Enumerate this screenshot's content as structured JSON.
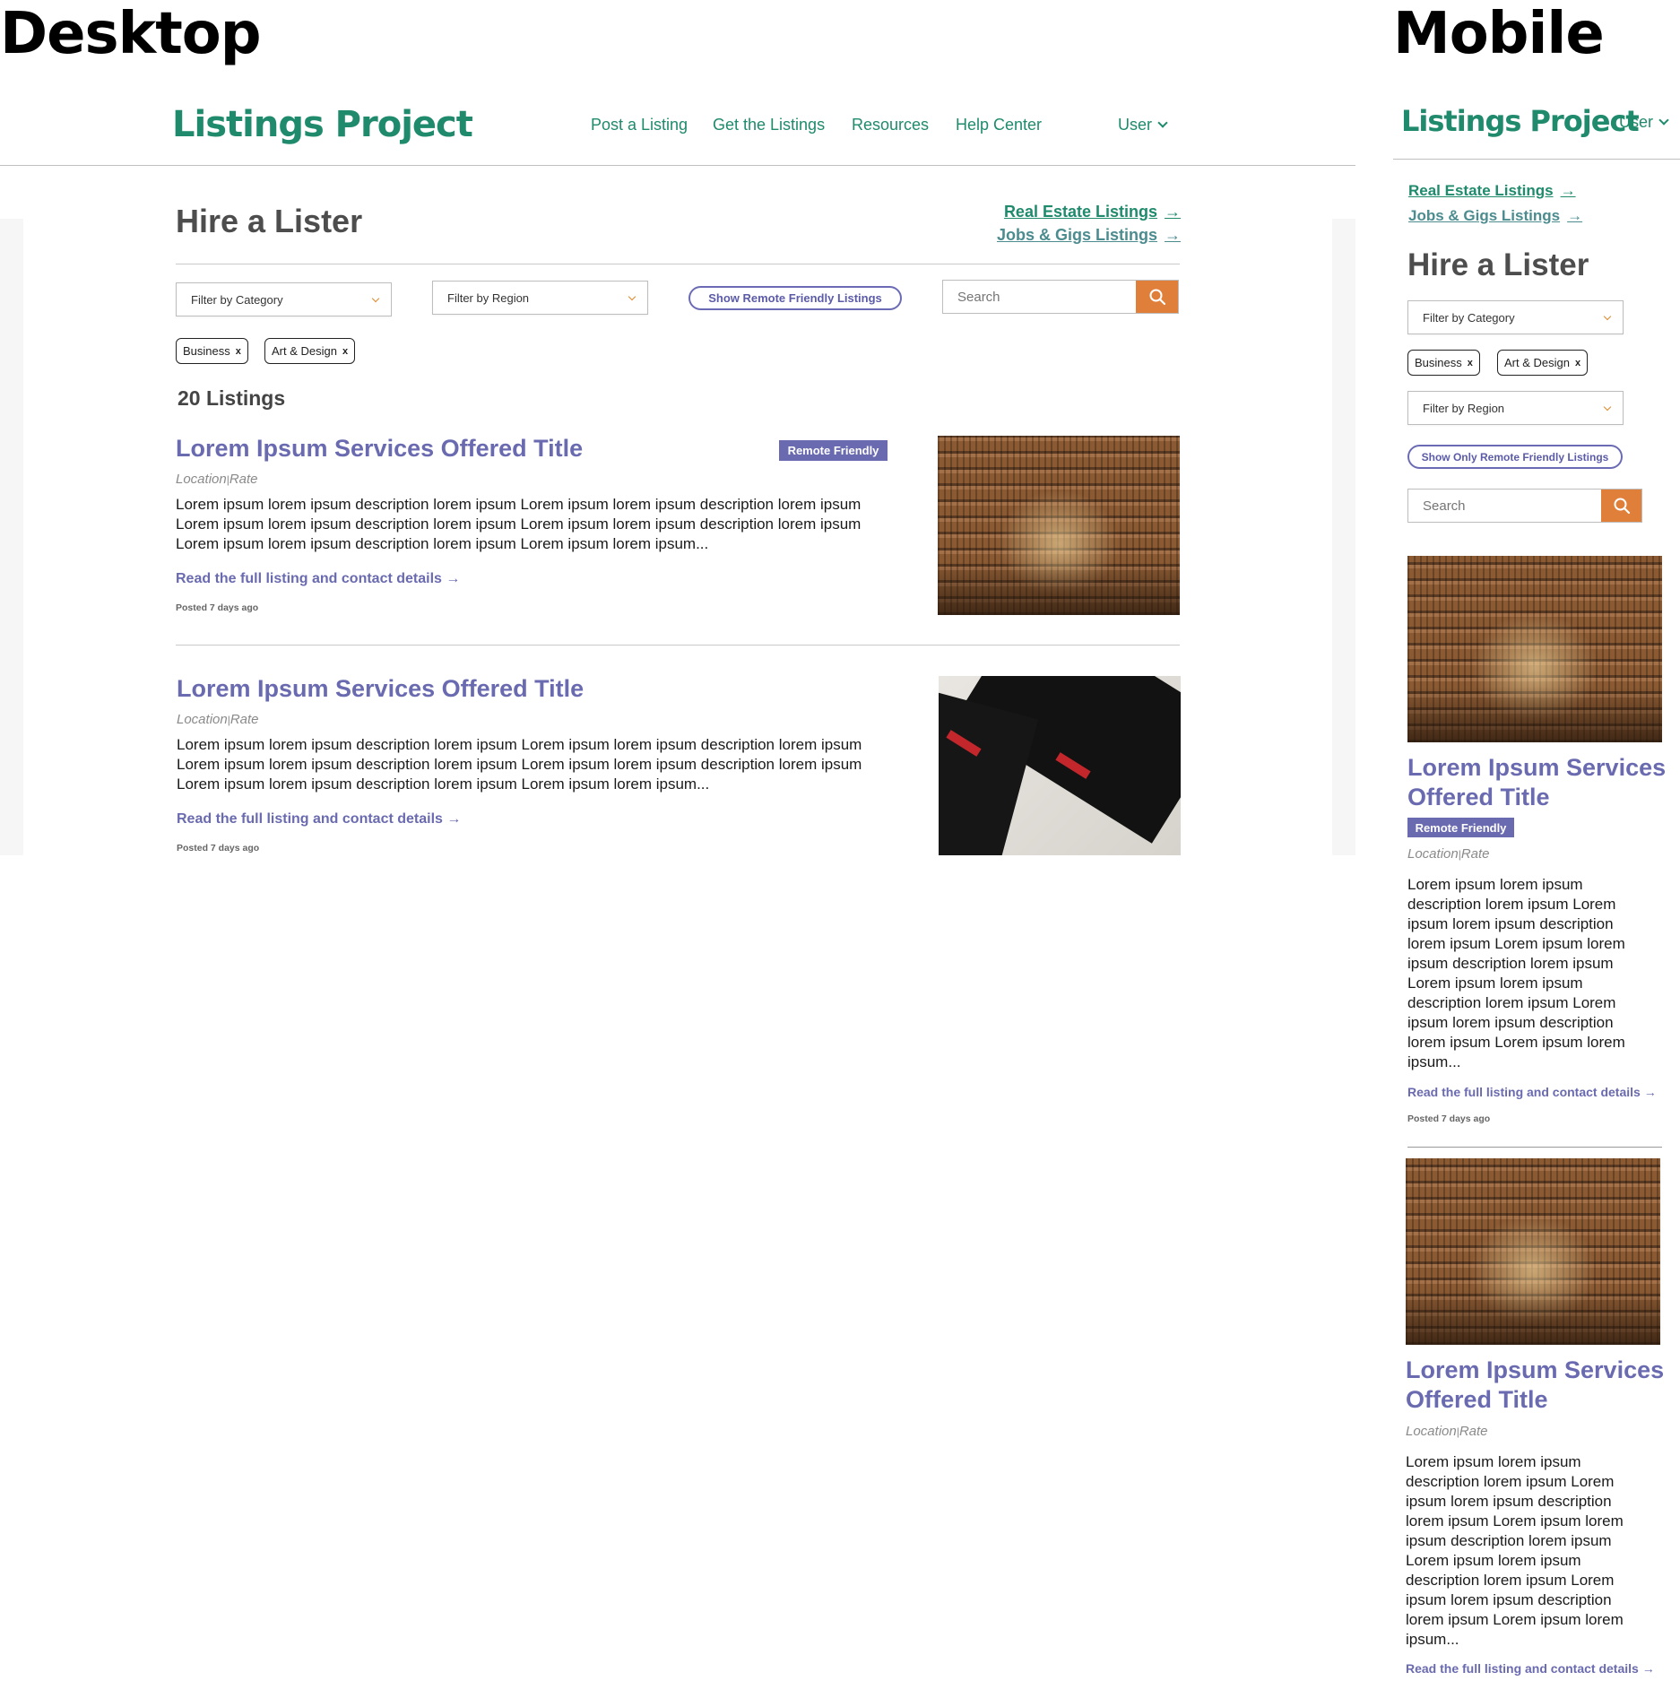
{
  "sections": {
    "desktop_label": "Desktop",
    "mobile_label": "Mobile"
  },
  "brand": {
    "logo_text": "Listings Project",
    "color": "#1f8a6c"
  },
  "nav": {
    "items": [
      "Post a Listing",
      "Get the Listings",
      "Resources",
      "Help Center"
    ],
    "user_label": "User"
  },
  "page": {
    "title": "Hire a Lister",
    "links": [
      "Real Estate Listings",
      "Jobs & Gigs Listings"
    ]
  },
  "filters": {
    "category_placeholder": "Filter by Category",
    "region_placeholder": "Filter by Region",
    "remote_button_desktop": "Show Remote Friendly Listings",
    "remote_button_mobile": "Show Only Remote Friendly Listings",
    "search_placeholder": "Search",
    "active_tags": [
      "Business",
      "Art & Design"
    ],
    "tag_remove_glyph": "x"
  },
  "results": {
    "count_label": "20 Listings"
  },
  "listings": [
    {
      "title": "Lorem Ipsum Services Offered Title",
      "badge": "Remote Friendly",
      "meta_location": "Location",
      "meta_separator": "|",
      "meta_rate": "Rate",
      "description": "Lorem ipsum lorem ipsum description lorem ipsum Lorem ipsum lorem ipsum description lorem ipsum Lorem ipsum lorem ipsum description lorem ipsum Lorem ipsum lorem ipsum description lorem ipsum Lorem ipsum lorem ipsum description lorem ipsum Lorem ipsum lorem ipsum...",
      "read_link": "Read the full listing and contact details",
      "posted": "Posted 7 days ago",
      "image": "library-photo"
    },
    {
      "title": "Lorem Ipsum Services Offered Title",
      "badge": "",
      "meta_location": "Location",
      "meta_separator": "|",
      "meta_rate": "Rate",
      "description": "Lorem ipsum lorem ipsum description lorem ipsum Lorem ipsum lorem ipsum description lorem ipsum Lorem ipsum lorem ipsum description lorem ipsum Lorem ipsum lorem ipsum description lorem ipsum Lorem ipsum lorem ipsum description lorem ipsum Lorem ipsum lorem ipsum...",
      "read_link": "Read the full listing and contact details",
      "posted": "Posted 7 days ago",
      "image": "business-cards-photo"
    }
  ],
  "mobile_listing_description": "Lorem ipsum lorem ipsum description lorem ipsum Lorem ipsum lorem ipsum description lorem ipsum Lorem ipsum lorem ipsum description lorem ipsum Lorem ipsum lorem ipsum description lorem ipsum  Lorem ipsum lorem ipsum description lorem ipsum Lorem ipsum lorem ipsum...",
  "colors": {
    "accent_purple": "#6a6ab0",
    "search_orange": "#e07f3a",
    "brand_green": "#1f8a6c"
  },
  "icons": {
    "search": "search-icon",
    "chevron": "chevron-down-icon",
    "arrow": "arrow-right-icon"
  }
}
